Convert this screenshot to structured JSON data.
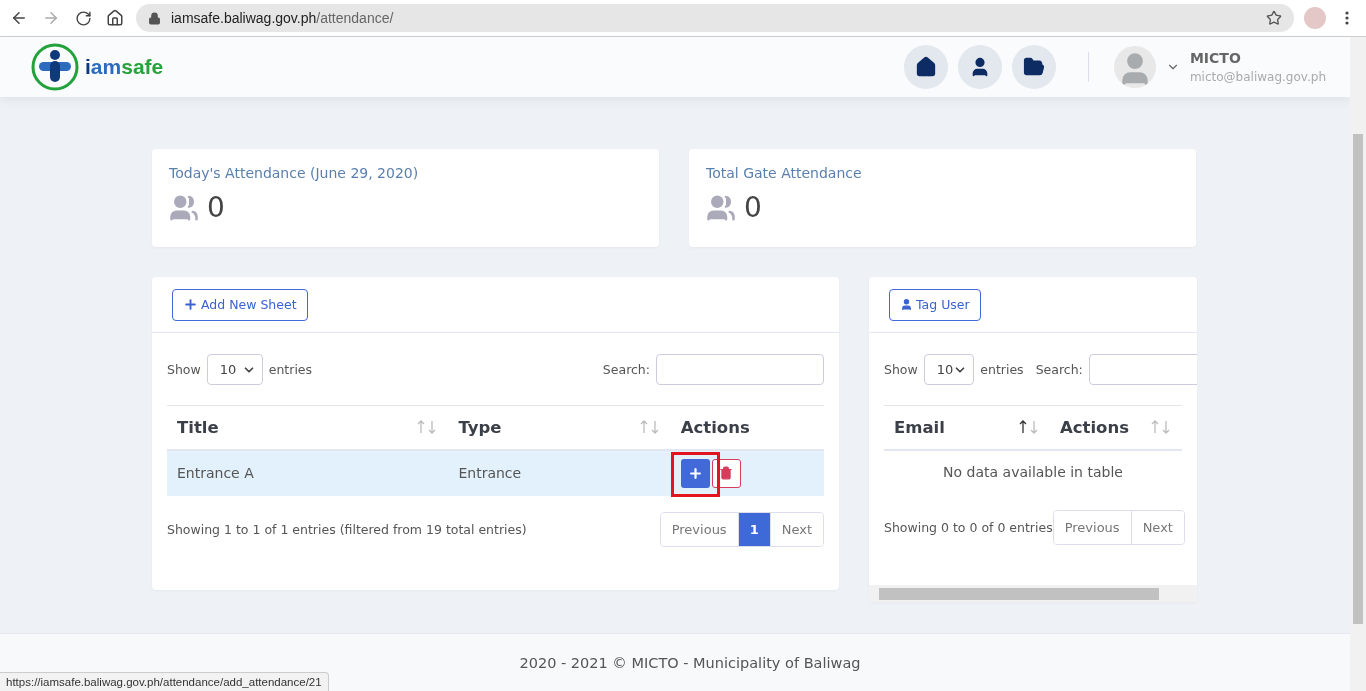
{
  "browser": {
    "url_host": "iamsafe.baliwag.gov.ph",
    "url_path": "/attendance/"
  },
  "header": {
    "brand_parts": [
      {
        "text": "i",
        "color": "#0e3a7c"
      },
      {
        "text": "am",
        "color": "#2d6bbf"
      },
      {
        "text": "safe",
        "color": "#28a23a"
      }
    ],
    "user_name": "MICTO",
    "user_email": "micto@baliwag.gov.ph"
  },
  "stats": [
    {
      "title": "Today's Attendance (June 29, 2020)",
      "value": "0"
    },
    {
      "title": "Total Gate Attendance",
      "value": "0"
    }
  ],
  "sheets": {
    "button": "Add New Sheet",
    "show_label": "Show",
    "page_size": "10",
    "entries_label": "entries",
    "search_label": "Search:",
    "columns": [
      {
        "label": "Title",
        "sortable": true,
        "sorted": false
      },
      {
        "label": "Type",
        "sortable": true,
        "sorted": false
      },
      {
        "label": "Actions",
        "sortable": false
      }
    ],
    "rows": [
      {
        "title": "Entrance A",
        "type": "Entrance",
        "selected": true
      }
    ],
    "info": "Showing 1 to 1 of 1 entries (filtered from 19 total entries)",
    "pages": [
      {
        "label": "Previous",
        "selected": false
      },
      {
        "label": "1",
        "selected": true
      },
      {
        "label": "Next",
        "selected": false
      }
    ]
  },
  "users": {
    "button": "Tag User",
    "show_label": "Show",
    "page_size": "10",
    "entries_label": "entries",
    "search_label": "Search:",
    "columns": [
      {
        "label": "Email",
        "sortable": true,
        "sorted": true
      },
      {
        "label": "Actions",
        "sortable": true,
        "sorted": false
      }
    ],
    "empty": "No data available in table",
    "info": "Showing 0 to 0 of 0 entries",
    "pages": [
      {
        "label": "Previous",
        "selected": false
      },
      {
        "label": "Next",
        "selected": false
      }
    ]
  },
  "footer": "2020 - 2021 © MICTO - Municipality of Baliwag",
  "status_url": "https://iamsafe.baliwag.gov.ph/attendance/add_attendance/21"
}
